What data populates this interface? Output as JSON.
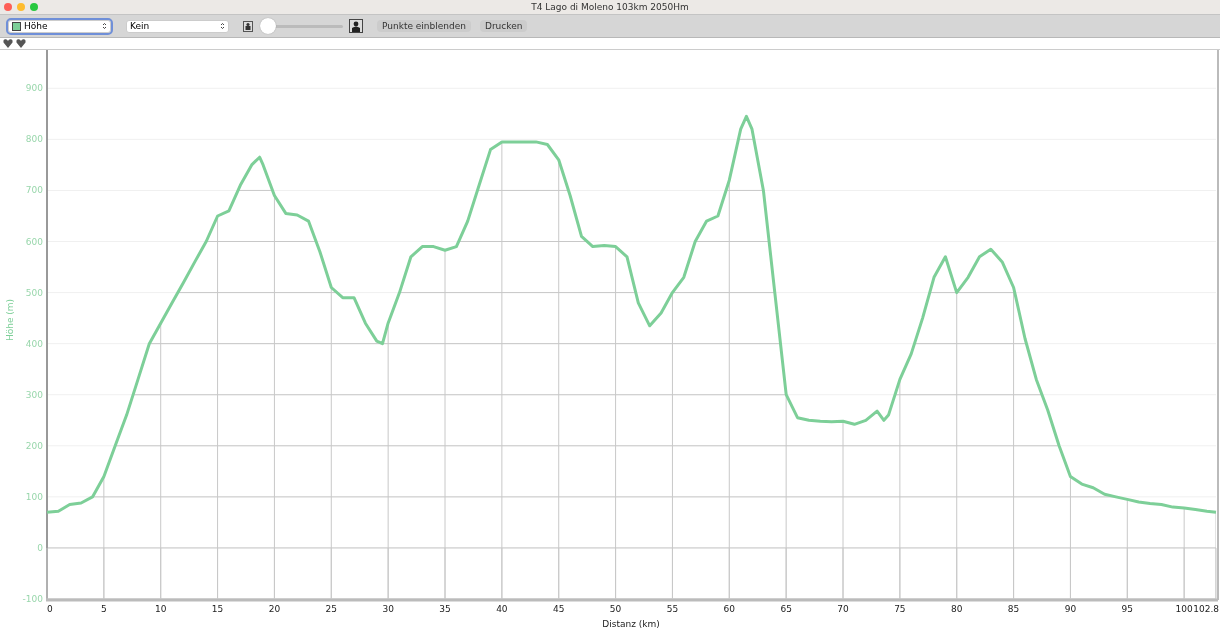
{
  "window": {
    "title": "T4 Lago di Moleno 103km 2050Hm"
  },
  "toolbar": {
    "series_select": {
      "focused": true
    },
    "compare_select": {
      "value": "Kein"
    },
    "zoom_slider": {
      "level": 0.04
    },
    "buttons": [
      "Punkte einblenden",
      "Drucken"
    ]
  },
  "chart": {
    "chart_data": {
      "type": "line",
      "grid": true,
      "xlabel": "Distanz (km)",
      "ylabel": "Höhe (m)",
      "x": [
        0,
        1,
        2,
        3,
        4,
        5,
        6,
        7,
        8,
        9,
        10,
        11,
        12,
        13,
        14,
        15,
        16,
        17,
        18,
        18.7,
        19,
        20,
        21,
        22,
        23,
        24,
        25,
        26,
        27,
        28,
        29,
        29.5,
        30,
        31,
        32,
        33,
        34,
        35,
        36,
        37,
        38,
        39,
        40,
        41,
        42,
        43,
        44,
        45,
        46,
        47,
        48,
        49,
        50,
        51,
        52,
        53,
        54,
        55,
        56,
        57,
        58,
        59,
        60,
        61,
        61.5,
        62,
        63,
        64,
        65,
        66,
        67,
        68,
        69,
        70,
        71,
        72,
        73,
        73.6,
        74,
        75,
        76,
        77,
        78,
        79,
        80,
        81,
        82,
        83,
        84,
        85,
        86,
        87,
        88,
        89,
        90,
        91,
        92,
        93,
        94,
        95,
        96,
        97,
        98,
        99,
        100,
        101,
        102,
        102.8
      ],
      "series": [
        {
          "name": "Höhe",
          "color": "#7dcf98",
          "values": [
            70,
            72,
            85,
            88,
            100,
            140,
            200,
            260,
            330,
            400,
            440,
            480,
            520,
            560,
            600,
            650,
            660,
            710,
            750,
            765,
            750,
            690,
            655,
            652,
            640,
            580,
            510,
            490,
            490,
            440,
            405,
            400,
            440,
            500,
            570,
            590,
            590,
            583,
            590,
            640,
            710,
            780,
            795,
            795,
            795,
            795,
            790,
            760,
            690,
            610,
            590,
            592,
            590,
            570,
            480,
            435,
            460,
            500,
            530,
            600,
            640,
            650,
            720,
            820,
            845,
            820,
            700,
            500,
            300,
            255,
            250,
            248,
            247,
            248,
            242,
            250,
            268,
            250,
            260,
            330,
            380,
            450,
            530,
            570,
            500,
            530,
            570,
            585,
            560,
            510,
            410,
            330,
            270,
            200,
            140,
            125,
            118,
            105,
            100,
            95,
            90,
            87,
            85,
            80,
            78,
            75,
            72,
            70
          ]
        }
      ],
      "xlim": [
        0,
        102.8
      ],
      "ylim": [
        -100,
        975
      ],
      "xticks": [
        0,
        5,
        10,
        15,
        20,
        25,
        30,
        35,
        40,
        45,
        50,
        55,
        60,
        65,
        70,
        75,
        80,
        85,
        90,
        95,
        100,
        {
          "value": 102.8,
          "label": "102.8"
        }
      ],
      "yticks": [
        -100,
        0,
        100,
        200,
        300,
        400,
        500,
        600,
        700,
        800,
        900
      ]
    }
  }
}
